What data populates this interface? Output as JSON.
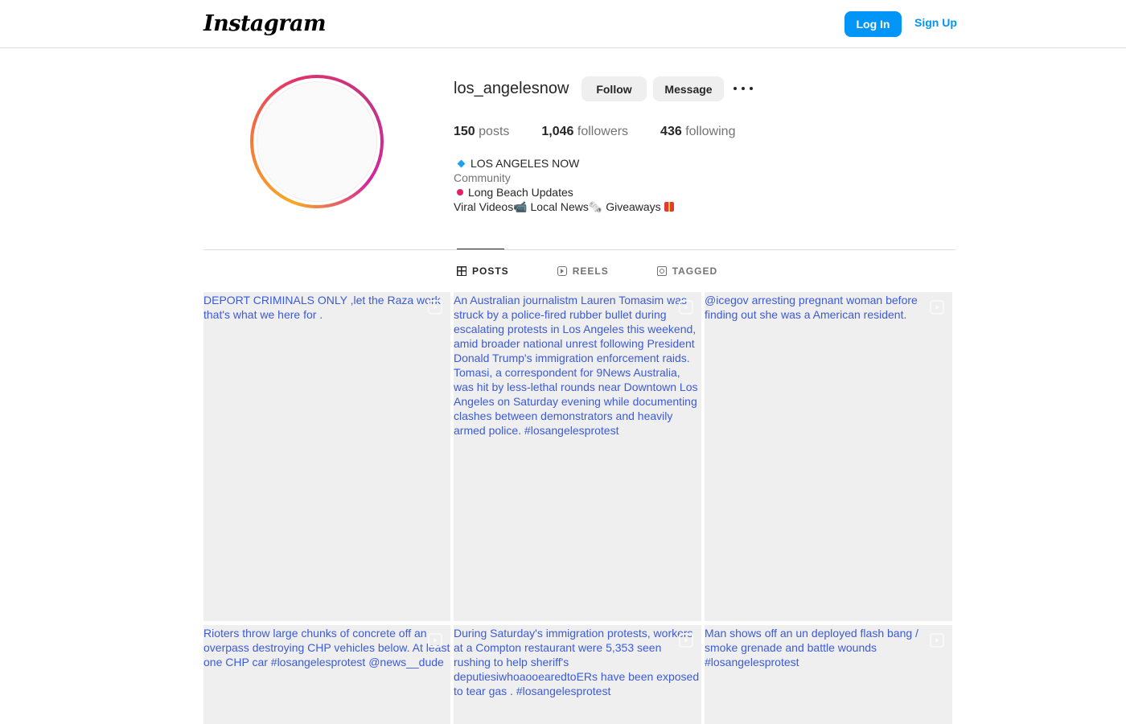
{
  "nav": {
    "logo": "Instagram",
    "login_label": "Log In",
    "signup_label": "Sign Up"
  },
  "profile": {
    "username": "los_angelesnow",
    "follow_label": "Follow",
    "message_label": "Message",
    "stats": {
      "posts_count": "150",
      "posts_label": "posts",
      "followers_count": "1,046",
      "followers_label": "followers",
      "following_count": "436",
      "following_label": "following"
    },
    "bio": {
      "name": "LOS ANGELES NOW",
      "category": "Community",
      "line1": "Long Beach Updates",
      "line2": "Viral Videos📹 Local News🗞️ Giveaways"
    }
  },
  "tabs": [
    {
      "label": "POSTS",
      "active": true
    },
    {
      "label": "REELS",
      "active": false
    },
    {
      "label": "TAGGED",
      "active": false
    }
  ],
  "posts": [
    {
      "alt": "DEPORT CRIMINALS ONLY ,let the Raza work that's what we here for ."
    },
    {
      "alt": "An Australian journalistm Lauren Tomasim was struck by a police-fired rubber bullet during escalating protests in Los Angeles this weekend, amid broader national unrest following President Donald Trump's immigration enforcement raids. Tomasi, a correspondent for 9News Australia, was hit by less-lethal rounds near Downtown Los Angeles on Saturday evening while documenting clashes between demonstrators and heavily armed police. #losangelesprotest"
    },
    {
      "alt": "@icegov arresting pregnant woman before finding out she was a American resident."
    },
    {
      "alt": "Rioters throw large chunks of concrete off an overpass destroying CHP vehicles below. At least one CHP car #losangelesprotest @news__dude"
    },
    {
      "alt": "During Saturday's immigration protests, workers at a Compton restaurant were 5,353 seen rushing to help sheriff's deputiesiwhoaooearedtoERs have been exposed to tear gas . #losangelesprotest"
    },
    {
      "alt": "Man shows off an un deployed flash bang / smoke grenade and battle wounds #losangelesprotest"
    }
  ],
  "colors": {
    "accent": "#0095f6",
    "link_text": "#3c5bd6",
    "tile_bg": "#efefef"
  }
}
